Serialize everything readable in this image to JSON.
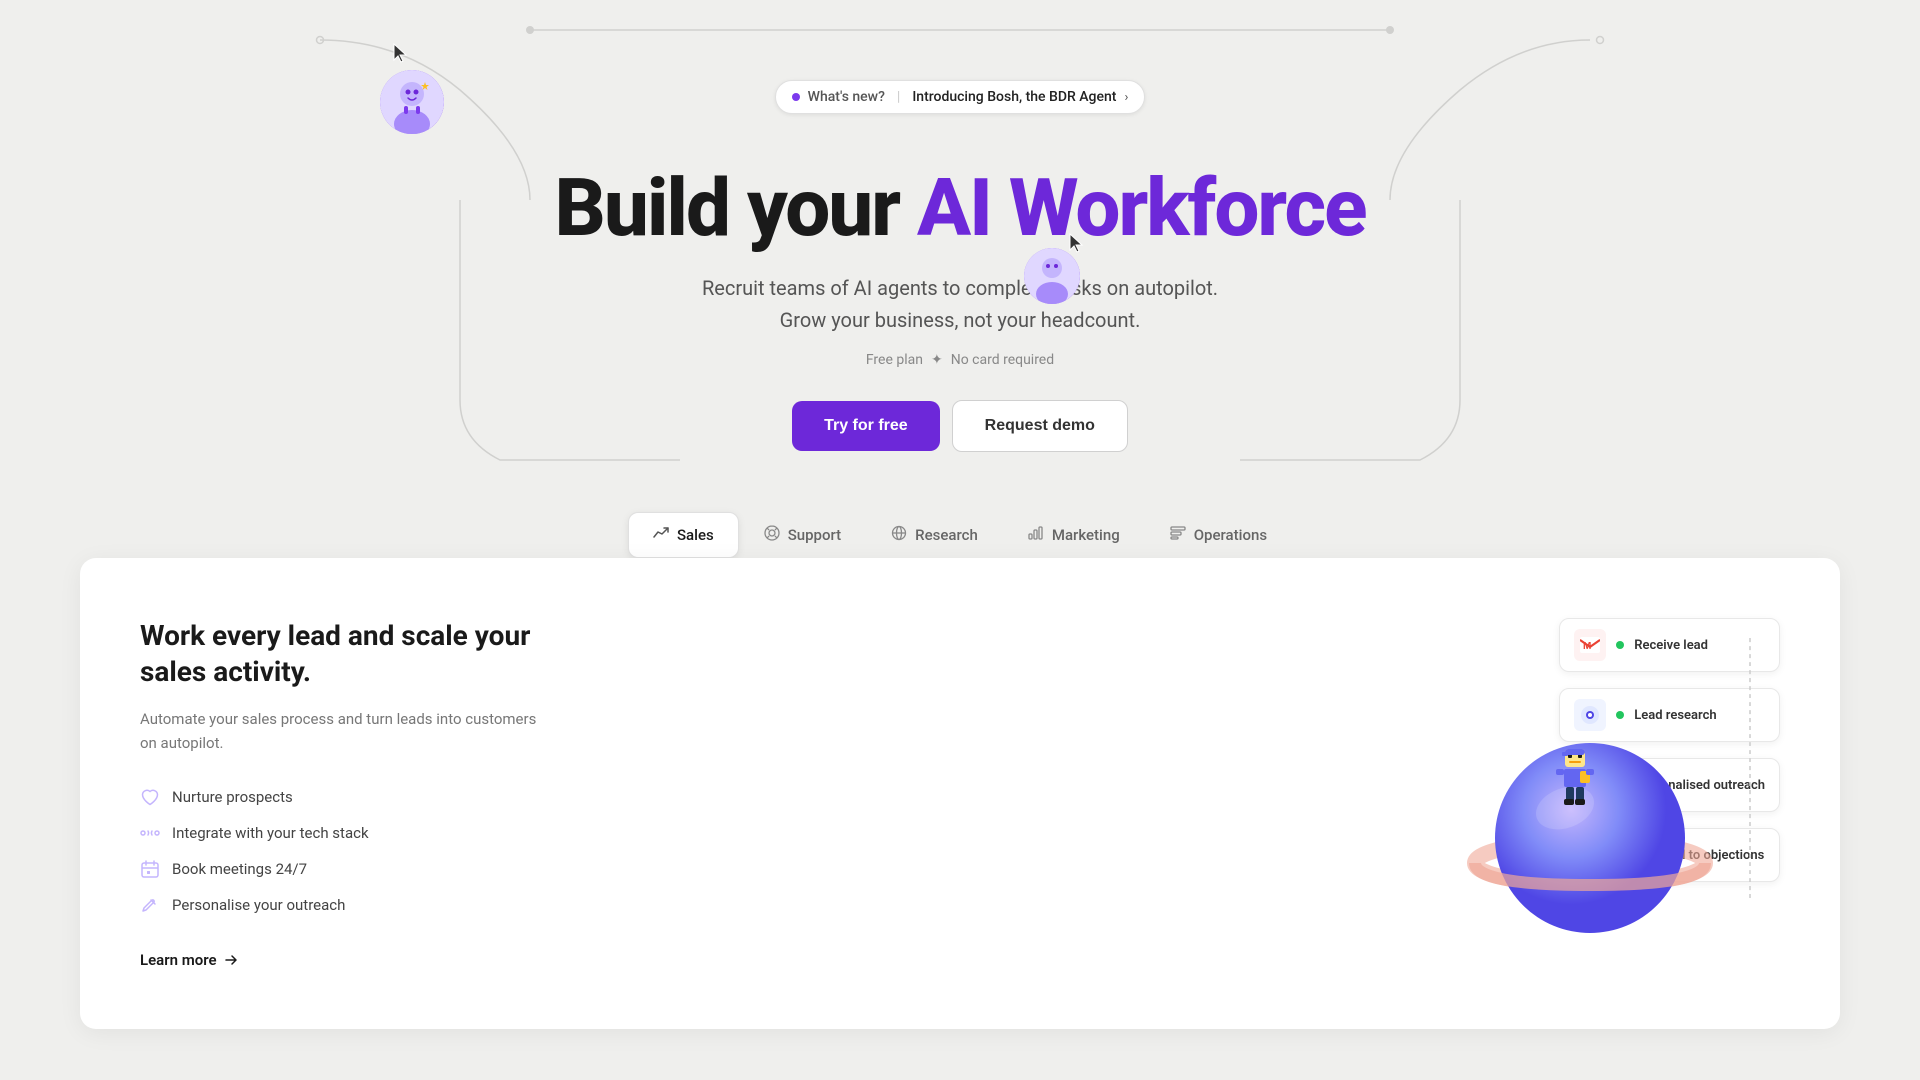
{
  "page": {
    "background": "#efefed"
  },
  "announcement": {
    "whats_new": "What's new?",
    "separator": "|",
    "introducing": "Introducing Bosh, the BDR Agent",
    "arrow": "›"
  },
  "hero": {
    "title_plain": "Build your",
    "title_highlight": "AI Workforce",
    "subtitle_line1": "Recruit teams of AI agents to complete tasks on autopilot.",
    "subtitle_line2": "Grow your business, not your headcount.",
    "meta_free_plan": "Free plan",
    "meta_separator": "✦",
    "meta_no_card": "No card required"
  },
  "cta": {
    "primary_label": "Try for free",
    "secondary_label": "Request demo"
  },
  "tabs": [
    {
      "id": "sales",
      "label": "Sales",
      "icon": "📈",
      "active": true
    },
    {
      "id": "support",
      "label": "Support",
      "icon": "💬",
      "active": false
    },
    {
      "id": "research",
      "label": "Research",
      "icon": "🌐",
      "active": false
    },
    {
      "id": "marketing",
      "label": "Marketing",
      "icon": "📊",
      "active": false
    },
    {
      "id": "operations",
      "label": "Operations",
      "icon": "🗂",
      "active": false
    }
  ],
  "sales_content": {
    "title": "Work every lead and scale your sales activity.",
    "description": "Automate your sales process and turn leads into customers on autopilot.",
    "features": [
      {
        "icon": "heart",
        "label": "Nurture prospects"
      },
      {
        "icon": "link",
        "label": "Integrate with your tech stack"
      },
      {
        "icon": "calendar",
        "label": "Book meetings 24/7"
      },
      {
        "icon": "pencil",
        "label": "Personalise your outreach"
      }
    ],
    "learn_more": "Learn more"
  },
  "flow_steps": [
    {
      "icon": "M",
      "icon_bg": "gmail",
      "dot_color": "green",
      "label": "Receive lead"
    },
    {
      "icon": "◉",
      "icon_bg": "perplexity",
      "dot_color": "green",
      "label": "Lead research"
    },
    {
      "icon": "in",
      "icon_bg": "linkedin",
      "dot_color": "orange",
      "label": "Personalised outreach"
    },
    {
      "icon": "in",
      "icon_bg": "linkedin",
      "dot_color": "gray",
      "label": "Respond to objections"
    }
  ],
  "colors": {
    "primary": "#6d28d9",
    "primary_light": "#a78bfa",
    "accent": "#6366f1"
  }
}
